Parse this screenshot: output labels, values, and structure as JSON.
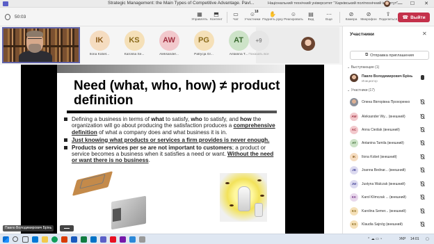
{
  "window": {
    "title": "Strategic Management: the Main Types of Competitive Advantage. Pavl...",
    "org": "Національний технічний університет \"Харківський політехнічний інститут\"",
    "minimize": "—",
    "maximize": "☐",
    "close": "✕"
  },
  "toolbar": {
    "timer": "50:03",
    "buttons": [
      {
        "label": "Управлять",
        "icon": "grid-icon"
      },
      {
        "label": "Контент",
        "icon": "share-icon"
      },
      {
        "label": "Чат",
        "icon": "chat-icon"
      },
      {
        "label": "Участники",
        "icon": "people-icon",
        "badge": "18"
      },
      {
        "label": "Поднять руку",
        "icon": "hand-icon"
      },
      {
        "label": "Реагировать",
        "icon": "emoji-icon"
      },
      {
        "label": "Вид",
        "icon": "layout-icon"
      },
      {
        "label": "Еще",
        "icon": "more-icon"
      },
      {
        "label": "Камера",
        "icon": "camera-icon"
      },
      {
        "label": "Микрофон",
        "icon": "mic-icon"
      },
      {
        "label": "Поделиться",
        "icon": "share-screen-icon"
      }
    ],
    "leave_label": "Выйти"
  },
  "video_strip": {
    "tiles": [
      {
        "initials": "IK",
        "name": "Ilona Kobet...",
        "bg": "#f5dcc0",
        "fg": "#8a5a1a"
      },
      {
        "initials": "KS",
        "name": "Karolina Se...",
        "bg": "#f5e0b8",
        "fg": "#8a6a1a"
      },
      {
        "initials": "AW",
        "name": "Aleksander...",
        "bg": "#f2c8cc",
        "fg": "#a03040"
      },
      {
        "initials": "PG",
        "name": "Patrycja Gr...",
        "bg": "#f5e0b8",
        "fg": "#8a6a1a"
      },
      {
        "initials": "AT",
        "name": "Antanina T...",
        "bg": "#cde3c8",
        "fg": "#3a6a30"
      }
    ],
    "more_tile": {
      "initials": "+9",
      "label": "Показать все"
    }
  },
  "slide": {
    "title": "Need (what, who, how) ≠ product definition",
    "b1_a": "Defining a business in terms of ",
    "b1_what": "what",
    "b1_b": " to satisfy, ",
    "b1_who": "who",
    "b1_c": " to satisfy, and ",
    "b1_how": "how",
    "b1_d": " the organization will go about producing the satisfaction produces a ",
    "b1_comp": "comprehensive definition",
    "b1_e": " of what a company does and what business it is in.",
    "b2": "Just knowing what products or services a firm provides is never enough.",
    "b3_a": "Products or services per se are not important to customers",
    "b3_b": "; a product or service becomes a business when it satisfies a need or want. ",
    "b3_c": "Without the need or want there is no business",
    "b3_d": "."
  },
  "speaker_label": "Павло Володимирович Брінь",
  "panel": {
    "title": "Участники",
    "invite": "Отправка приглашения",
    "presenters_header": "Выступающие (1)",
    "attendees_header": "Участники (17)",
    "presenter": {
      "name": "Павло Володимирович Брінь",
      "role": "Инициатор"
    },
    "participants": [
      {
        "initials": "",
        "name": "Олена Вікторівна Прохоренко",
        "bg": "",
        "fg": "",
        "photo": true
      },
      {
        "initials": "AW",
        "name": "Aleksander Wy... (внешний)",
        "bg": "#f2c8cc",
        "fg": "#a03040"
      },
      {
        "initials": "AC",
        "name": "Anna Cieślak (внешний)",
        "bg": "#f2c8cc",
        "fg": "#a03040"
      },
      {
        "initials": "AT",
        "name": "Antanina Tamila (внешний)",
        "bg": "#cde3c8",
        "fg": "#3a6a30"
      },
      {
        "initials": "IK",
        "name": "Ilona Kobet (внешний)",
        "bg": "#f5dcc0",
        "fg": "#8a5a1a"
      },
      {
        "initials": "JB",
        "name": "Joanna Bednar... (внешний)",
        "bg": "#dcdaf0",
        "fg": "#4a4a9a"
      },
      {
        "initials": "JW",
        "name": "Justyna Walczak (внешний)",
        "bg": "#dcdaf0",
        "fg": "#4a4a9a"
      },
      {
        "initials": "KK",
        "name": "Karol Klimczak ... (внешний)",
        "bg": "#e8d8ec",
        "fg": "#7a3a8a"
      },
      {
        "initials": "KS",
        "name": "Karolina Semer... (внешний)",
        "bg": "#f5e0b8",
        "fg": "#8a6a1a"
      },
      {
        "initials": "KS",
        "name": "Klaudia Sajnóg (внешний)",
        "bg": "#f5e0b8",
        "fg": "#8a6a1a"
      }
    ]
  },
  "taskbar": {
    "lang": "УКР",
    "time": "14:01"
  }
}
